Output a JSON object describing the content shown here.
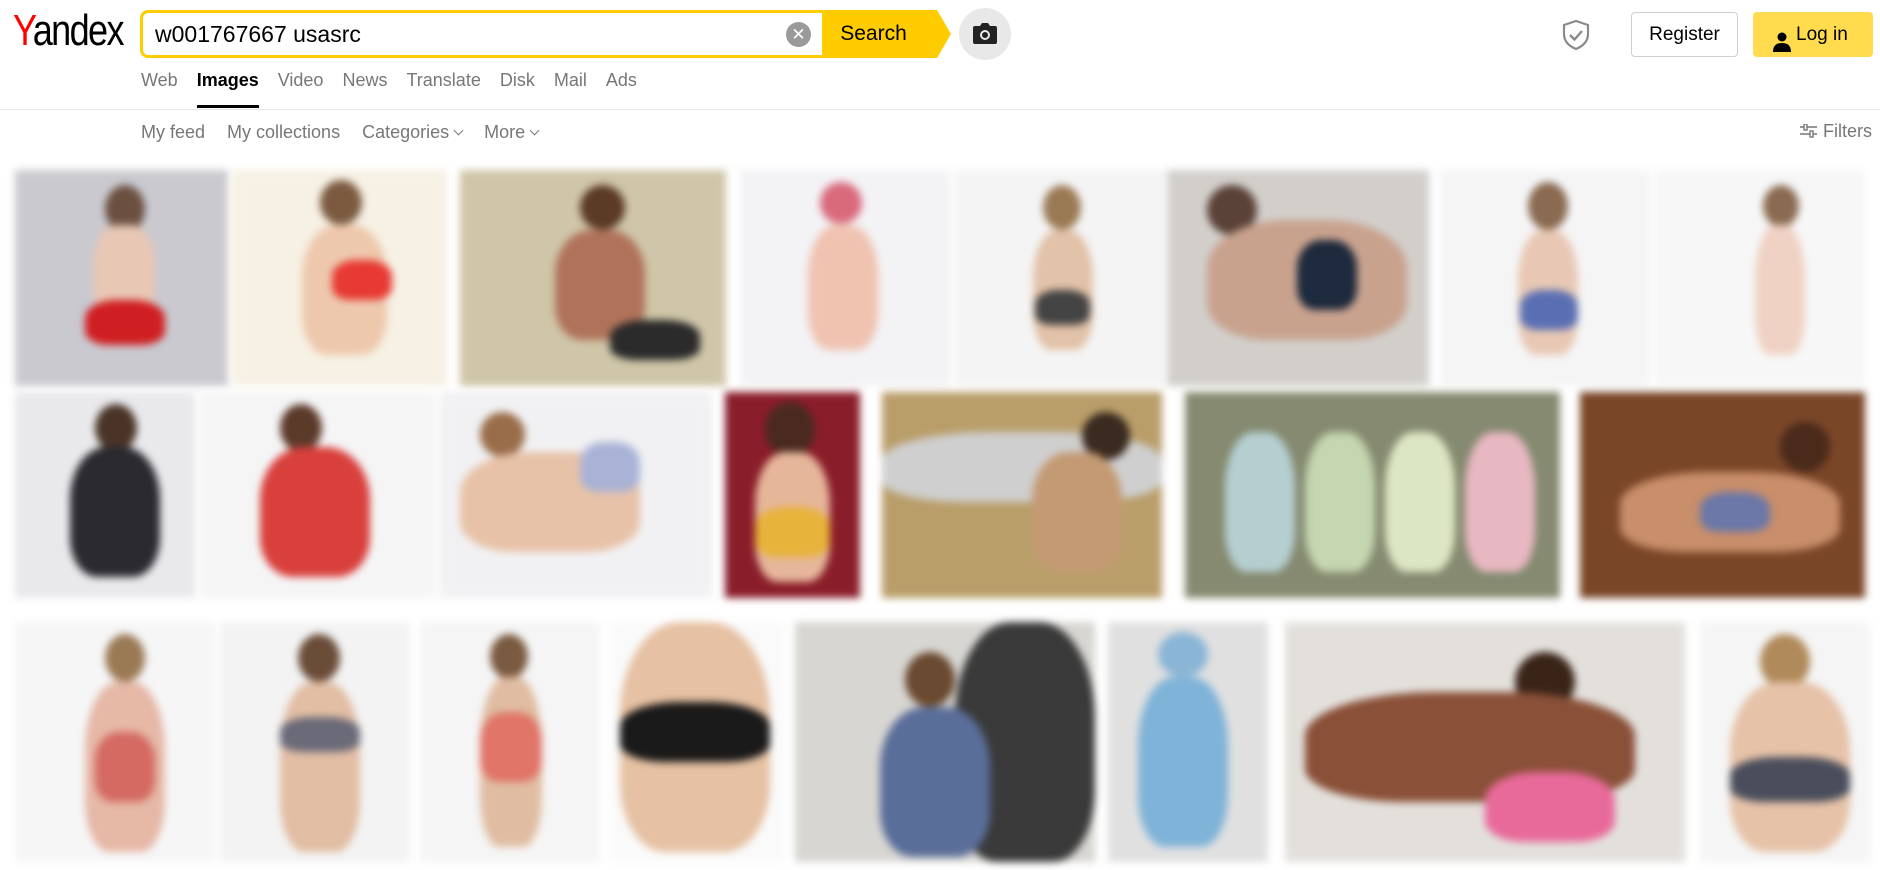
{
  "logo": {
    "first": "Y",
    "rest": "andex"
  },
  "search": {
    "value": "w001767667 usasrc",
    "button_label": "Search",
    "clear_glyph": "✕"
  },
  "icons": {
    "camera": "camera-icon",
    "shield": "shield-icon",
    "user": "user-icon",
    "filters": "sliders-icon"
  },
  "auth": {
    "register_label": "Register",
    "login_label": "Log in"
  },
  "services": [
    {
      "label": "Web",
      "active": false
    },
    {
      "label": "Images",
      "active": true
    },
    {
      "label": "Video",
      "active": false
    },
    {
      "label": "News",
      "active": false
    },
    {
      "label": "Translate",
      "active": false
    },
    {
      "label": "Disk",
      "active": false
    },
    {
      "label": "Mail",
      "active": false
    },
    {
      "label": "Ads",
      "active": false
    }
  ],
  "subnav": {
    "my_feed": "My feed",
    "my_collections": "My collections",
    "categories": "Categories",
    "more": "More",
    "filters": "Filters"
  },
  "colors": {
    "accent": "#ffcc00",
    "login_bg": "#ffdb4d",
    "logo_red": "#ff0000"
  },
  "results_note": "blurred image thumbnails"
}
